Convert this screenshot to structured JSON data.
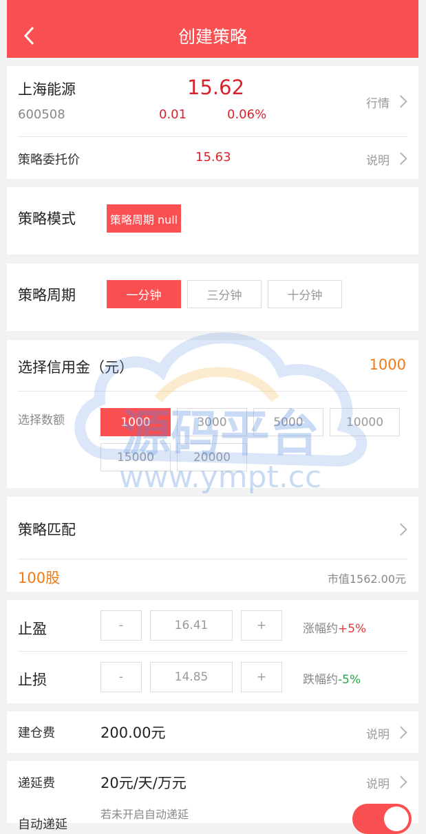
{
  "header": {
    "title": "创建策略"
  },
  "stock": {
    "name": "上海能源",
    "code": "600508",
    "price": "15.62",
    "change": "0.01",
    "change_pct": "0.06%",
    "market_link": "行情"
  },
  "entrust": {
    "label": "策略委托价",
    "value": "15.63",
    "link": "说明"
  },
  "mode": {
    "label": "策略模式",
    "value": "策略周期 null"
  },
  "period": {
    "label": "策略周期",
    "options": [
      "一分钟",
      "三分钟",
      "十分钟"
    ],
    "selected": "一分钟"
  },
  "credit": {
    "label": "选择信用金（元）",
    "value": "1000",
    "amount_label": "选择数额",
    "amounts": [
      "1000",
      "3000",
      "5000",
      "10000",
      "15000",
      "20000"
    ],
    "selected": "1000"
  },
  "match": {
    "label": "策略匹配",
    "shares": "100股",
    "market_value": "市值1562.00元"
  },
  "take_profit": {
    "label": "止盈",
    "minus": "-",
    "value": "16.41",
    "plus": "+",
    "note": "涨幅约",
    "pct": "+5%"
  },
  "stop_loss": {
    "label": "止损",
    "minus": "-",
    "value": "14.85",
    "plus": "+",
    "note": "跌幅约",
    "pct": "-5%"
  },
  "open_fee": {
    "label": "建仓费",
    "value": "200.00元",
    "link": "说明"
  },
  "defer_fee": {
    "label": "递延费",
    "value": "20元/天/万元",
    "link": "说明"
  },
  "auto_defer": {
    "label": "自动递延",
    "note": "若未开启自动递延",
    "enabled": true
  },
  "watermark": {
    "text_cn": "源码平台",
    "text_url": "www.ympt.cc"
  },
  "colors": {
    "primary": "#fb5052",
    "price_red": "#d9232b",
    "orange": "#f37a12",
    "green": "#27a844"
  }
}
